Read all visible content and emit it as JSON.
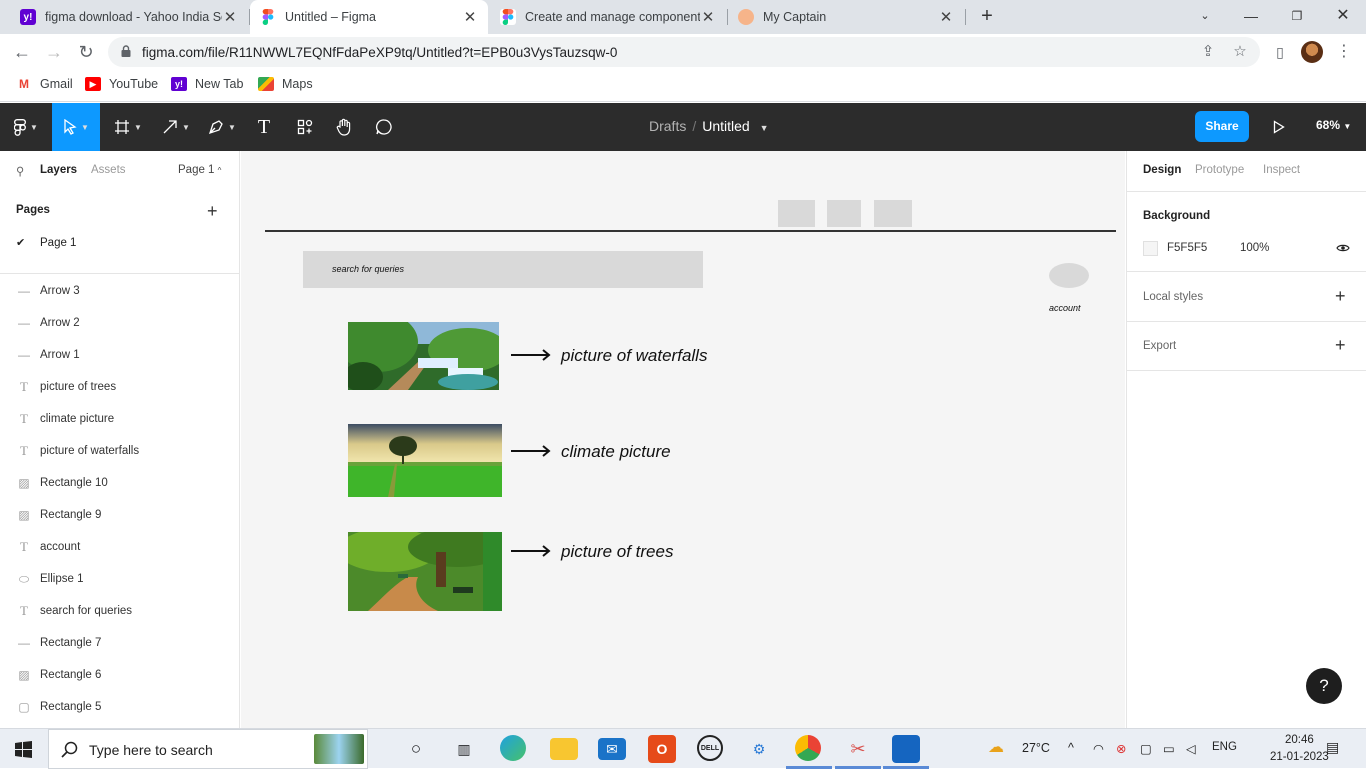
{
  "browser": {
    "tabs": [
      {
        "title": "figma download - Yahoo India Se",
        "active": false
      },
      {
        "title": "Untitled – Figma",
        "active": true
      },
      {
        "title": "Create and manage component p",
        "active": false
      },
      {
        "title": "My Captain",
        "active": false
      }
    ],
    "url": "figma.com/file/R11NWWL7EQNfFdaPeXP9tq/Untitled?t=EPB0u3VysTauzsqw-0",
    "bookmarks": [
      "Gmail",
      "YouTube",
      "New Tab",
      "Maps"
    ]
  },
  "figma": {
    "breadcrumb": {
      "folder": "Drafts",
      "file": "Untitled"
    },
    "share_label": "Share",
    "zoom": "68%",
    "left_panel": {
      "tabs": {
        "layers": "Layers",
        "assets": "Assets",
        "page_selector": "Page 1"
      },
      "pages_header": "Pages",
      "current_page": "Page 1",
      "layers": [
        {
          "name": "Arrow 3",
          "kind": "line"
        },
        {
          "name": "Arrow 2",
          "kind": "line"
        },
        {
          "name": "Arrow 1",
          "kind": "line"
        },
        {
          "name": "picture of trees",
          "kind": "text"
        },
        {
          "name": "climate picture",
          "kind": "text"
        },
        {
          "name": "picture of waterfalls",
          "kind": "text"
        },
        {
          "name": "Rectangle 10",
          "kind": "image"
        },
        {
          "name": "Rectangle 9",
          "kind": "image"
        },
        {
          "name": "account",
          "kind": "text"
        },
        {
          "name": "Ellipse 1",
          "kind": "ellipse"
        },
        {
          "name": "search for queries",
          "kind": "text"
        },
        {
          "name": "Rectangle 7",
          "kind": "line"
        },
        {
          "name": "Rectangle 6",
          "kind": "image"
        },
        {
          "name": "Rectangle 5",
          "kind": "rect"
        }
      ]
    },
    "canvas": {
      "search_text": "search for queries",
      "account_text": "account",
      "captions": [
        "picture of waterfalls",
        "climate picture",
        "picture of trees"
      ]
    },
    "right_panel": {
      "tabs": [
        "Design",
        "Prototype",
        "Inspect"
      ],
      "background_label": "Background",
      "background_hex": "F5F5F5",
      "background_opacity": "100%",
      "local_styles": "Local styles",
      "export": "Export"
    }
  },
  "taskbar": {
    "search_placeholder": "Type here to search",
    "temperature": "27°C",
    "language": "ENG",
    "time": "20:46",
    "date": "21-01-2023"
  },
  "colors": {
    "figma_blue": "#0d99ff",
    "toolbar_bg": "#2c2c2c",
    "canvas_bg": "#f5f5f5",
    "placeholder_gray": "#d9d9d9"
  }
}
